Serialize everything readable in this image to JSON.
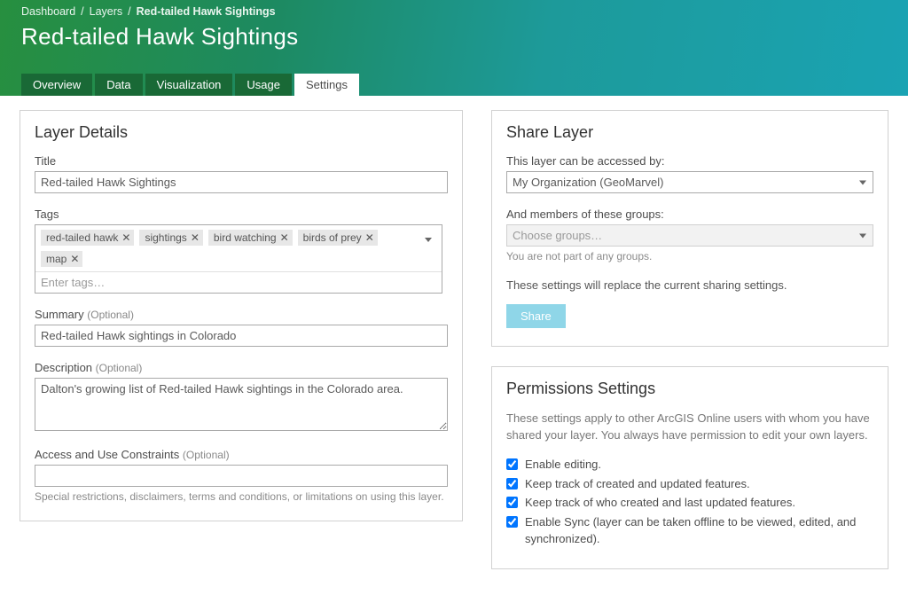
{
  "breadcrumb": {
    "root": "Dashboard",
    "mid": "Layers",
    "current": "Red-tailed Hawk Sightings"
  },
  "page_title": "Red-tailed Hawk Sightings",
  "tabs": [
    {
      "label": "Overview",
      "active": false
    },
    {
      "label": "Data",
      "active": false
    },
    {
      "label": "Visualization",
      "active": false
    },
    {
      "label": "Usage",
      "active": false
    },
    {
      "label": "Settings",
      "active": true
    }
  ],
  "layer_details": {
    "heading": "Layer Details",
    "title_label": "Title",
    "title_value": "Red-tailed Hawk Sightings",
    "tags_label": "Tags",
    "tags": [
      "red-tailed hawk",
      "sightings",
      "bird watching",
      "birds of prey",
      "map"
    ],
    "tags_placeholder": "Enter tags…",
    "summary_label": "Summary",
    "optional": "(Optional)",
    "summary_value": "Red-tailed Hawk sightings in Colorado",
    "description_label": "Description",
    "description_value": "Dalton's growing list of Red-tailed Hawk sightings in the Colorado area.",
    "access_label": "Access and Use Constraints",
    "access_value": "",
    "access_hint": "Special restrictions, disclaimers, terms and conditions, or limitations on using this layer."
  },
  "share": {
    "heading": "Share Layer",
    "access_label": "This layer can be accessed by:",
    "access_value": "My Organization (GeoMarvel)",
    "groups_label": "And members of these groups:",
    "groups_placeholder": "Choose groups…",
    "groups_hint": "You are not part of any groups.",
    "note": "These settings will replace the current sharing settings.",
    "button": "Share"
  },
  "permissions": {
    "heading": "Permissions Settings",
    "desc": "These settings apply to other ArcGIS Online users with whom you have shared your layer. You always have permission to edit your own layers.",
    "items": [
      {
        "label": "Enable editing.",
        "checked": true
      },
      {
        "label": "Keep track of created and updated features.",
        "checked": true
      },
      {
        "label": "Keep track of who created and last updated features.",
        "checked": true
      },
      {
        "label": "Enable Sync (layer can be taken offline to be viewed, edited, and synchronized).",
        "checked": true
      }
    ]
  }
}
